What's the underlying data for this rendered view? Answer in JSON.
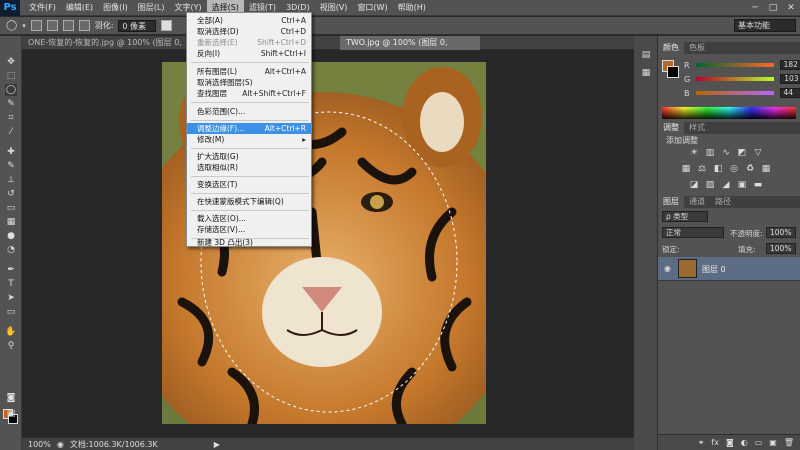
{
  "menubar": {
    "logo": "Ps",
    "items": [
      "文件(F)",
      "编辑(E)",
      "图像(I)",
      "图层(L)",
      "文字(Y)",
      "选择(S)",
      "滤镜(T)",
      "3D(D)",
      "视图(V)",
      "窗口(W)",
      "帮助(H)"
    ],
    "window_buttons": [
      "─",
      "□",
      "✕"
    ]
  },
  "options": {
    "feather_label": "羽化:",
    "feather_value": "0 像素",
    "workspace": "基本功能"
  },
  "tabs": [
    {
      "label": "ONE-恢复的-恢复的.jpg @ 100% (图层 0, RGB/8) *",
      "close": "×"
    },
    {
      "label": "TWO.jpg @ 100% (图层 0, RGB/8#) *",
      "close": "×"
    }
  ],
  "select_menu": [
    {
      "label": "全部(A)",
      "shortcut": "Ctrl+A",
      "disabled": false
    },
    {
      "label": "取消选择(D)",
      "shortcut": "Ctrl+D",
      "disabled": false
    },
    {
      "label": "重新选择(E)",
      "shortcut": "Shift+Ctrl+D",
      "disabled": true
    },
    {
      "label": "反向(I)",
      "shortcut": "Shift+Ctrl+I",
      "disabled": false
    },
    {
      "label": "所有图层(L)",
      "shortcut": "Alt+Ctrl+A",
      "disabled": false
    },
    {
      "label": "取消选择图层(S)",
      "shortcut": "",
      "disabled": false
    },
    {
      "label": "查找图层",
      "shortcut": "Alt+Shift+Ctrl+F",
      "disabled": false
    },
    {
      "label": "色彩范围(C)...",
      "shortcut": "",
      "disabled": false
    },
    {
      "label": "调整边缘(F)...",
      "shortcut": "Alt+Ctrl+R",
      "disabled": false,
      "highlighted": true
    },
    {
      "label": "修改(M)",
      "shortcut": "▸",
      "disabled": false
    },
    {
      "label": "扩大选取(G)",
      "shortcut": "",
      "disabled": false
    },
    {
      "label": "选取相似(R)",
      "shortcut": "",
      "disabled": false
    },
    {
      "label": "变换选区(T)",
      "shortcut": "",
      "disabled": false
    },
    {
      "label": "在快速蒙版模式下编辑(Q)",
      "shortcut": "",
      "disabled": false
    },
    {
      "label": "载入选区(O)...",
      "shortcut": "",
      "disabled": false
    },
    {
      "label": "存储选区(V)...",
      "shortcut": "",
      "disabled": false
    },
    {
      "label": "新建 3D 凸出(3)",
      "shortcut": "",
      "disabled": false
    }
  ],
  "color_panel": {
    "tabs": [
      "颜色",
      "色板"
    ],
    "channels": [
      {
        "label": "R",
        "value": "182"
      },
      {
        "label": "G",
        "value": "103"
      },
      {
        "label": "B",
        "value": "44"
      }
    ],
    "fg_color": "#b6672c"
  },
  "adjust_panel": {
    "tabs": [
      "调整",
      "样式"
    ],
    "title": "添加调整"
  },
  "layers_panel": {
    "tabs": [
      "图层",
      "通道",
      "路径"
    ],
    "kind": "ρ 类型",
    "blend": "正常",
    "opacity_label": "不透明度:",
    "opacity": "100%",
    "lock_label": "锁定:",
    "fill_label": "填充:",
    "fill": "100%",
    "layer_name": "图层 0"
  },
  "status": {
    "zoom": "100%",
    "doc": "文档:1006.3K/1006.3K"
  }
}
